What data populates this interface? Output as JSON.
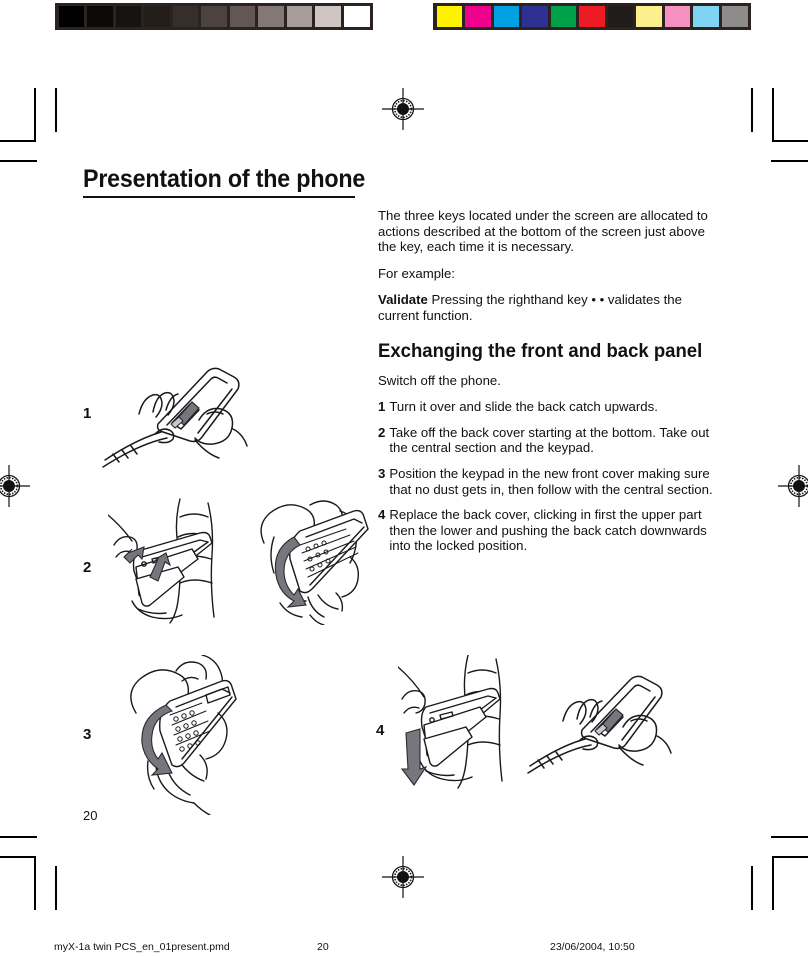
{
  "document": {
    "title": "Presentation of the phone",
    "page_number": "20"
  },
  "prepress": {
    "gray_bar_name": "grayscale-calibration-bar",
    "gray_patches": [
      "#000000",
      "#0b0908",
      "#171311",
      "#231d1a",
      "#362e2b",
      "#4c423f",
      "#625754",
      "#837876",
      "#a69c99",
      "#cfc5c2",
      "#ffffff"
    ],
    "color_bar_name": "color-calibration-bar",
    "color_patches": [
      "#fff200",
      "#ec008c",
      "#00a0e3",
      "#2e3192",
      "#00a14b",
      "#ed1c24",
      "#211c1a",
      "#fdef8c",
      "#f590c1",
      "#7fd4f4",
      "#8c8c8c"
    ]
  },
  "intro": {
    "paragraph1": "The three keys located under the screen are allocated to actions described at the bottom of the screen just above the key, each time it is necessary.",
    "paragraph2": "For example:",
    "validate_label": "Validate",
    "validate_text": "  Pressing the righthand key  • •  validates the current function."
  },
  "section": {
    "heading": "Exchanging the front and back panel",
    "intro": "Switch off the phone.",
    "steps": [
      {
        "num": "1",
        "text": "Turn it over and slide the back catch upwards."
      },
      {
        "num": "2",
        "text": "Take off the back cover starting at the bottom. Take out the central section and the keypad."
      },
      {
        "num": "3",
        "text": "Position the keypad in the new front cover making sure that no dust gets in, then follow with the central section."
      },
      {
        "num": "4",
        "text": "Replace the back cover, clicking in first the  upper part then the lower and pushing the back catch downwards into the locked position."
      }
    ]
  },
  "figures": [
    {
      "label": "1",
      "caption": "hand sliding back catch upwards on phone"
    },
    {
      "label": "2",
      "caption": "removing back cover and taking out central section and keypad"
    },
    {
      "label": "3",
      "caption": "positioning the keypad into the new front cover"
    },
    {
      "label": "4",
      "caption": "replacing the back cover and pushing the back catch down"
    }
  ],
  "footer": {
    "file": "myX-1a twin PCS_en_01present.pmd",
    "page": "20",
    "date": "23/06/2004, 10:50"
  }
}
